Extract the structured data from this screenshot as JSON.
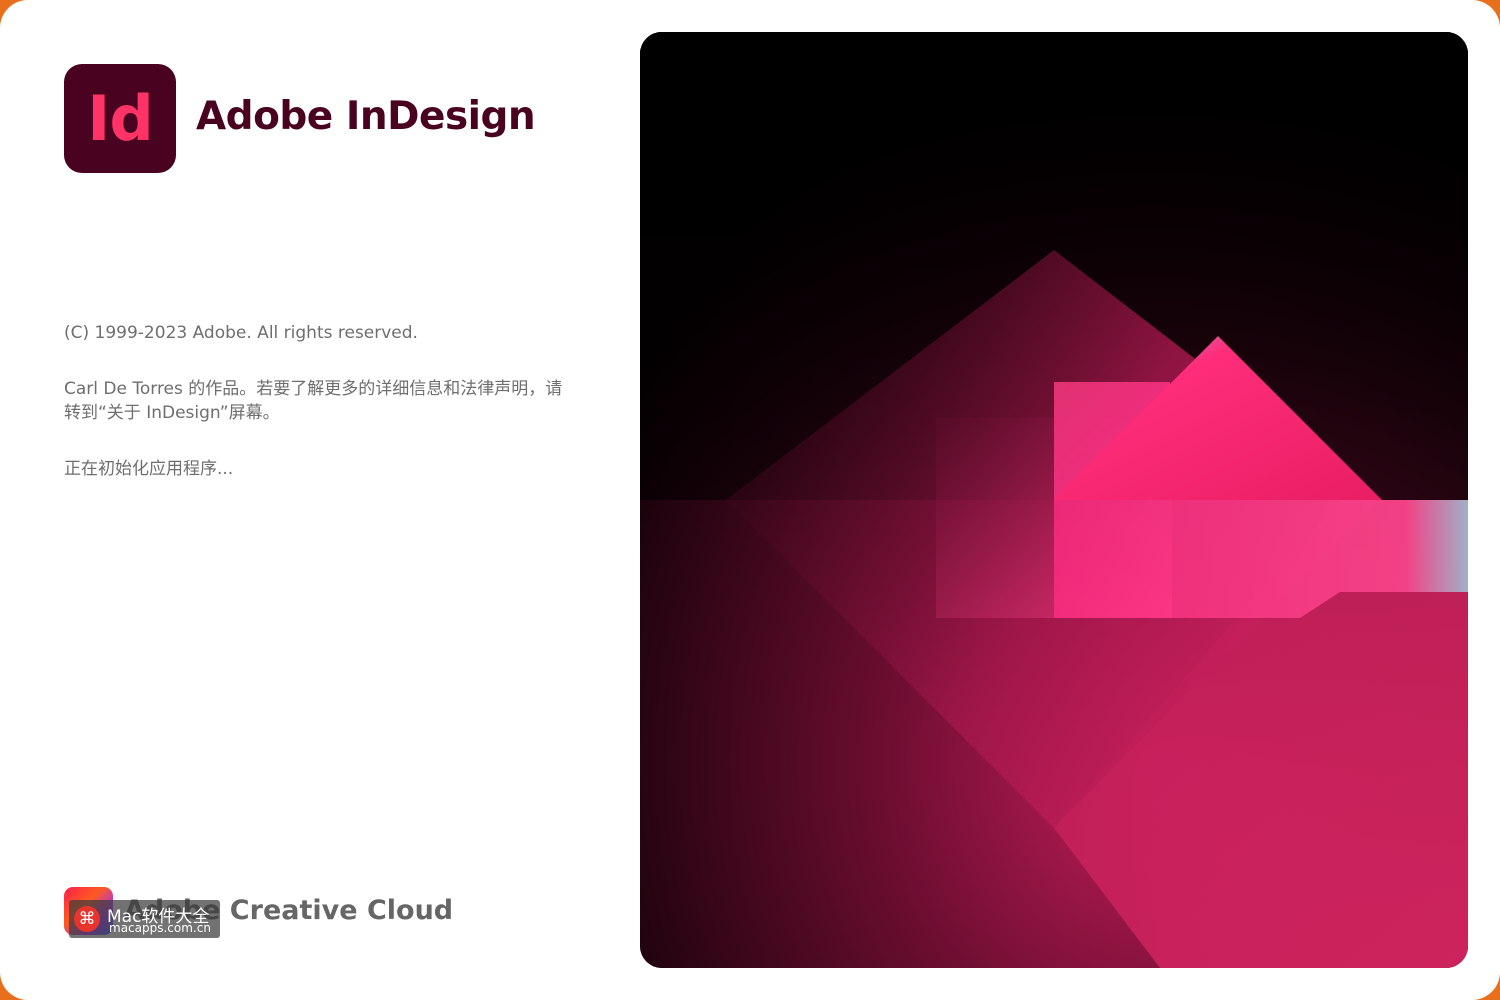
{
  "app": {
    "icon_label": "Id",
    "title": "Adobe InDesign"
  },
  "info": {
    "copyright": "(C) 1999-2023 Adobe. All rights reserved.",
    "credit": "Carl De Torres 的作品。若要了解更多的详细信息和法律声明，请转到“关于 InDesign”屏幕。",
    "status": "正在初始化应用程序..."
  },
  "footer": {
    "cc_label": "Adobe Creative Cloud"
  },
  "watermark": {
    "badge": "⌘",
    "title": "Mac软件大全",
    "url": "macapps.com.cn"
  },
  "colors": {
    "brand_dark": "#49021f",
    "brand_pink": "#ff3366",
    "background_accent": "#e8701c"
  },
  "icons": {
    "app": "indesign-app-icon",
    "cc": "creative-cloud-icon"
  }
}
